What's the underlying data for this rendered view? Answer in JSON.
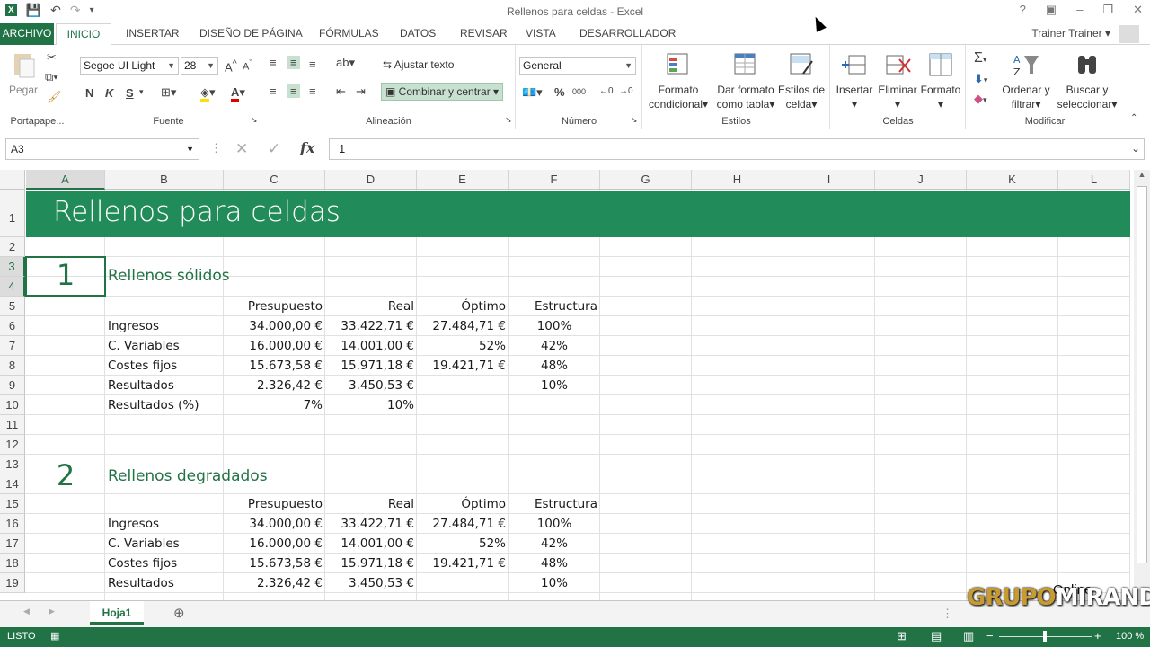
{
  "window": {
    "title": "Rellenos para celdas - Excel",
    "user": "Trainer Trainer",
    "help": "?",
    "ribbon_toggle": "▣",
    "minimize": "–",
    "restore": "❐",
    "close": "✕"
  },
  "tabs": [
    "ARCHIVO",
    "INICIO",
    "INSERTAR",
    "DISEÑO DE PÁGINA",
    "FÓRMULAS",
    "DATOS",
    "REVISAR",
    "VISTA",
    "DESARROLLADOR"
  ],
  "ribbon": {
    "paste": "Pegar",
    "portapapeles": "Portapape...",
    "fuente": "Fuente",
    "alineacion": "Alineación",
    "numero": "Número",
    "estilos": "Estilos",
    "celdas": "Celdas",
    "modificar": "Modificar",
    "font_name": "Segoe UI Light",
    "font_size": "28",
    "wrap": "Ajustar texto",
    "merge": "Combinar y centrar",
    "number_format": "General",
    "bold": "N",
    "italic": "K",
    "underline": "S",
    "cond_format_1": "Formato",
    "cond_format_2": "condicional",
    "table_1": "Dar formato",
    "table_2": "como tabla",
    "styles_1": "Estilos de",
    "styles_2": "celda",
    "insert": "Insertar",
    "delete": "Eliminar",
    "format": "Formato",
    "sort_1": "Ordenar y",
    "sort_2": "filtrar",
    "find_1": "Buscar y",
    "find_2": "seleccionar",
    "percent": "%",
    "thousands": "000"
  },
  "formula": {
    "namebox": "A3",
    "value": "1",
    "fx": "fx"
  },
  "columns": [
    "A",
    "B",
    "C",
    "D",
    "E",
    "F",
    "G",
    "H",
    "I",
    "J",
    "K",
    "L"
  ],
  "rows": [
    "1",
    "2",
    "3",
    "4",
    "5",
    "6",
    "7",
    "8",
    "9",
    "10",
    "11",
    "12",
    "13",
    "14",
    "15",
    "16",
    "17",
    "18",
    "19"
  ],
  "sheet": {
    "title": "Rellenos para celdas",
    "section1": {
      "num": "1",
      "title": "Rellenos sólidos"
    },
    "section2": {
      "num": "2",
      "title": "Rellenos degradados"
    },
    "headers": [
      "Presupuesto",
      "Real",
      "Óptimo",
      "Estructura"
    ],
    "table1": [
      {
        "label": "Ingresos",
        "c": "34.000,00 €",
        "d": "33.422,71 €",
        "e": "27.484,71 €",
        "f": "100%"
      },
      {
        "label": "C. Variables",
        "c": "16.000,00 €",
        "d": "14.001,00 €",
        "e": "52%",
        "f": "42%"
      },
      {
        "label": "Costes fijos",
        "c": "15.673,58 €",
        "d": "15.971,18 €",
        "e": "19.421,71 €",
        "f": "48%"
      },
      {
        "label": "Resultados",
        "c": "2.326,42 €",
        "d": "3.450,53 €",
        "e": "",
        "f": "10%"
      },
      {
        "label": "Resultados (%)",
        "c": "7%",
        "d": "10%",
        "e": "",
        "f": ""
      }
    ],
    "table2": [
      {
        "label": "Ingresos",
        "c": "34.000,00 €",
        "d": "33.422,71 €",
        "e": "27.484,71 €",
        "f": "100%"
      },
      {
        "label": "C. Variables",
        "c": "16.000,00 €",
        "d": "14.001,00 €",
        "e": "52%",
        "f": "42%"
      },
      {
        "label": "Costes fijos",
        "c": "15.673,58 €",
        "d": "15.971,18 €",
        "e": "19.421,71 €",
        "f": "48%"
      },
      {
        "label": "Resultados",
        "c": "2.326,42 €",
        "d": "3.450,53 €",
        "e": "",
        "f": "10%"
      }
    ]
  },
  "sheettab": "Hoja1",
  "status": {
    "ready": "LISTO",
    "zoom": "100 %"
  },
  "watermark": {
    "part1": "GRUPO",
    "part2": "MIRANDA",
    "online": "Online"
  }
}
